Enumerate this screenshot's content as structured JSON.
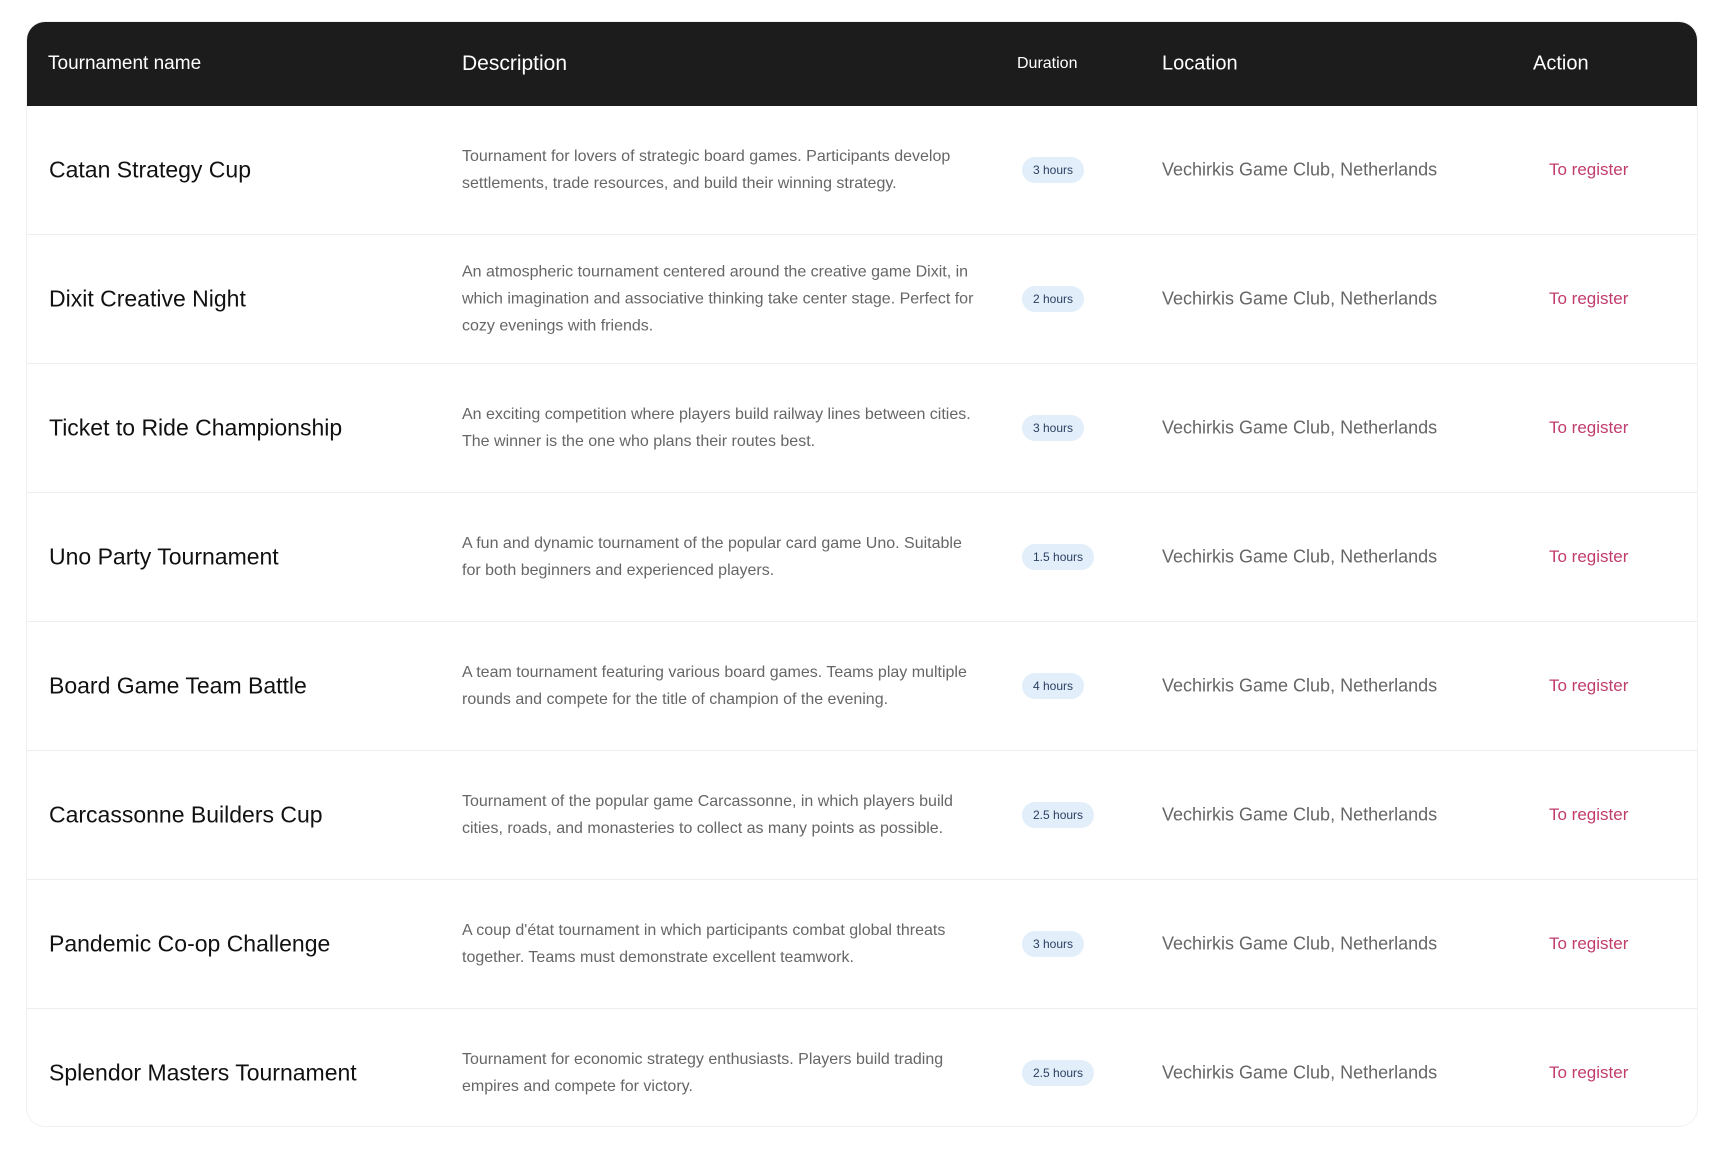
{
  "header": {
    "name": "Tournament name",
    "description": "Description",
    "duration": "Duration",
    "location": "Location",
    "action": "Action"
  },
  "colors": {
    "header_bg": "#1c1c1c",
    "action_text": "#c13c6c",
    "badge_bg": "#e3eefb",
    "badge_text": "#2a3f60"
  },
  "rows": [
    {
      "name": "Catan Strategy Cup",
      "description": "Tournament for lovers of strategic board games. Participants develop settlements, trade resources, and build their winning strategy.",
      "duration": "3 hours",
      "location": "Vechirkis Game Club, Netherlands",
      "action": "To register"
    },
    {
      "name": "Dixit Creative Night",
      "description": "An atmospheric tournament centered around the creative game Dixit, in which imagination and associative thinking take center stage. Perfect for cozy evenings with friends.",
      "duration": "2 hours",
      "location": "Vechirkis Game Club, Netherlands",
      "action": "To register"
    },
    {
      "name": "Ticket to Ride Championship",
      "description": "An exciting competition where players build railway lines between cities. The winner is the one who plans their routes best.",
      "duration": "3 hours",
      "location": "Vechirkis Game Club, Netherlands",
      "action": "To register"
    },
    {
      "name": "Uno Party Tournament",
      "description": "A fun and dynamic tournament of the popular card game Uno. Suitable for both beginners and experienced players.",
      "duration": "1.5 hours",
      "location": "Vechirkis Game Club, Netherlands",
      "action": "To register"
    },
    {
      "name": "Board Game Team Battle",
      "description": "A team tournament featuring various board games. Teams play multiple rounds and compete for the title of champion of the evening.",
      "duration": "4 hours",
      "location": "Vechirkis Game Club, Netherlands",
      "action": "To register"
    },
    {
      "name": "Carcassonne Builders Cup",
      "description": "Tournament of the popular game Carcassonne, in which players build cities, roads, and monasteries to collect as many points as possible.",
      "duration": "2.5 hours",
      "location": "Vechirkis Game Club, Netherlands",
      "action": "To register"
    },
    {
      "name": "Pandemic Co-op Challenge",
      "description": "A coup d'état tournament in which participants combat global threats together. Teams must demonstrate excellent teamwork.",
      "duration": "3 hours",
      "location": "Vechirkis Game Club, Netherlands",
      "action": "To register"
    },
    {
      "name": "Splendor Masters Tournament",
      "description": "Tournament for economic strategy enthusiasts. Players build trading empires and compete for victory.",
      "duration": "2.5 hours",
      "location": "Vechirkis Game Club, Netherlands",
      "action": "To register"
    }
  ]
}
